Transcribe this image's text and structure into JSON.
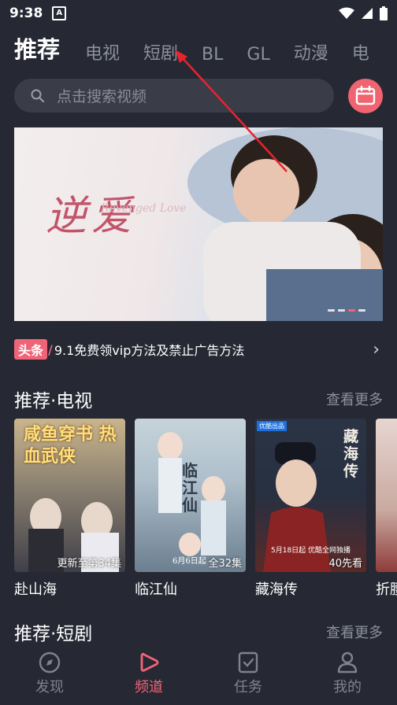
{
  "status": {
    "time": "9:38",
    "notification_letter": "A"
  },
  "tabs": [
    "推荐",
    "电视",
    "短剧",
    "BL",
    "GL",
    "动漫",
    "电"
  ],
  "search": {
    "placeholder": "点击搜索视频"
  },
  "banner": {
    "title": "逆爱",
    "subtitle": "Revenged Love"
  },
  "news": {
    "tag": "头条",
    "text": "9.1免费领vip方法及禁止广告方法"
  },
  "section_tv": {
    "title": "推荐·电视",
    "more": "查看更多"
  },
  "section_short": {
    "title": "推荐·短剧",
    "more": "查看更多"
  },
  "cards": [
    {
      "title": "赴山海",
      "badge": "更新至第34集",
      "poster_text": "咸鱼穿书 热血武侠"
    },
    {
      "title": "临江仙",
      "badge": "全32集",
      "poster_text": "临江仙",
      "poster_date": "6月6日起"
    },
    {
      "title": "藏海传",
      "badge": "40先看",
      "poster_text": "藏海传",
      "poster_top_badge": "优酷出品",
      "poster_date": "5月18日起 优酷全网独播"
    },
    {
      "title": "折腰",
      "badge": ""
    }
  ],
  "bottom_nav": [
    {
      "label": "发现",
      "icon": "compass-icon",
      "active": false
    },
    {
      "label": "频道",
      "icon": "play-icon",
      "active": true
    },
    {
      "label": "任务",
      "icon": "task-icon",
      "active": false
    },
    {
      "label": "我的",
      "icon": "user-icon",
      "active": false
    }
  ],
  "colors": {
    "accent": "#f06478",
    "background": "#262833",
    "annotation_arrow": "#e8232f"
  }
}
